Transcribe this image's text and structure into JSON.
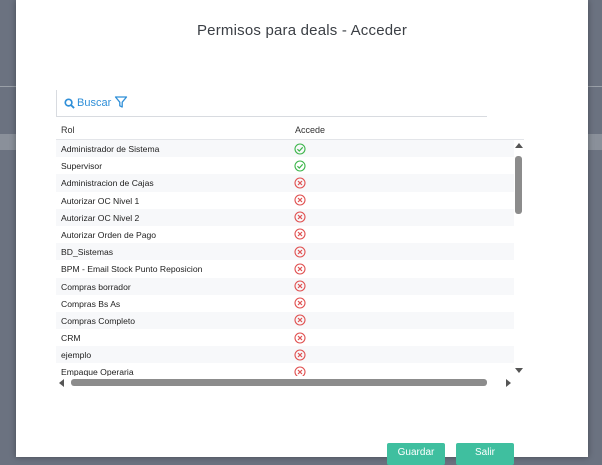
{
  "modal": {
    "title": "Permisos para deals - Acceder"
  },
  "toolbar": {
    "search_label": "Buscar"
  },
  "grid": {
    "columns": [
      "Rol",
      "Accede"
    ],
    "rows": [
      {
        "rol": "Administrador de Sistema",
        "accede": true
      },
      {
        "rol": "Supervisor",
        "accede": true
      },
      {
        "rol": "Administracion de Cajas",
        "accede": false
      },
      {
        "rol": "Autorizar OC Nivel 1",
        "accede": false
      },
      {
        "rol": "Autorizar OC Nivel 2",
        "accede": false
      },
      {
        "rol": "Autorizar Orden de Pago",
        "accede": false
      },
      {
        "rol": "BD_Sistemas",
        "accede": false
      },
      {
        "rol": "BPM - Email Stock Punto Reposicion",
        "accede": false
      },
      {
        "rol": "Compras borrador",
        "accede": false
      },
      {
        "rol": "Compras Bs As",
        "accede": false
      },
      {
        "rol": "Compras Completo",
        "accede": false
      },
      {
        "rol": "CRM",
        "accede": false
      },
      {
        "rol": "ejemplo",
        "accede": false
      },
      {
        "rol": "Empaque Operaria",
        "accede": false
      }
    ]
  },
  "footer": {
    "save_label": "Guardar",
    "exit_label": "Salir"
  },
  "colors": {
    "accent": "#2f8fd8",
    "check": "#3cb54a",
    "deny": "#e05050",
    "button": "#3fbf9f"
  }
}
